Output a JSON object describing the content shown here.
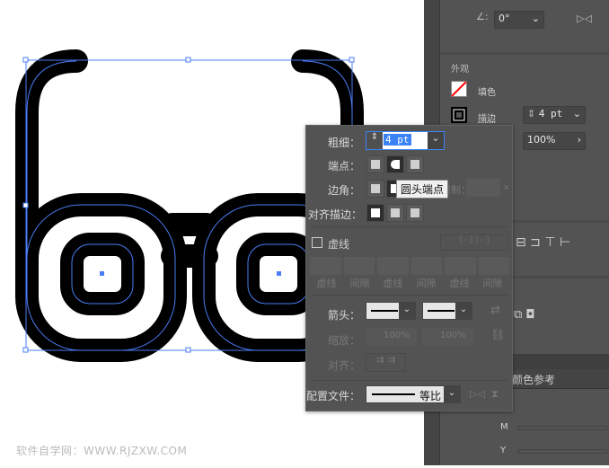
{
  "properties_panel": {
    "angle_value": "0°",
    "appearance_title": "外观",
    "fill_label": "填色",
    "stroke_label": "描边",
    "stroke_weight": "4 pt",
    "opacity": "100%",
    "color_guide_tab": "颜色参考",
    "cmyk_labels": [
      "M",
      "Y"
    ]
  },
  "stroke_popup": {
    "weight_label": "粗细：",
    "weight_value": "4 pt",
    "cap_label": "端点：",
    "corner_label": "边角：",
    "limit_label": "限制：",
    "limit_x": "x",
    "align_label": "对齐描边：",
    "dashed_label": "虚线",
    "dashed_checked": false,
    "dash_fields": [
      "虚线",
      "间隙",
      "虚线",
      "间隙",
      "虚线",
      "间隙"
    ],
    "arrow_label": "箭头：",
    "scale_label": "缩放：",
    "scale_values": [
      "100%",
      "100%"
    ],
    "arrow_align_label": "对齐：",
    "profile_label": "配置文件：",
    "profile_value": "等比"
  },
  "tooltip": "圆头端点",
  "watermark": "软件自学网：WWW.RJZXW.COM",
  "colors": {
    "panel": "#535353",
    "selection": "#4a7cf5",
    "field_highlight": "#3b82f6"
  }
}
